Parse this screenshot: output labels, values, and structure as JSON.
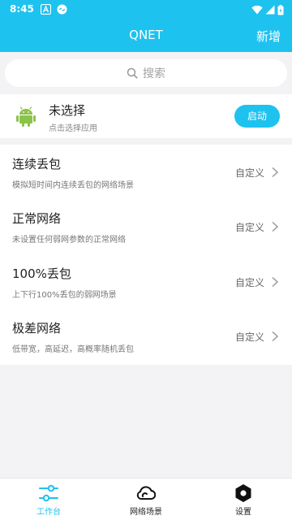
{
  "status_bar": {
    "time": "8:45"
  },
  "app_bar": {
    "title": "QNET",
    "add_label": "新增"
  },
  "search": {
    "placeholder": "搜索"
  },
  "app_selector": {
    "name": "未选择",
    "hint": "点击选择应用",
    "start_label": "启动"
  },
  "scenarios": [
    {
      "title": "连续丢包",
      "desc": "模拟短时间内连续丢包的网络场景",
      "label": "自定义"
    },
    {
      "title": "正常网络",
      "desc": "未设置任何弱网参数的正常网络",
      "label": "自定义"
    },
    {
      "title": "100%丢包",
      "desc": "上下行100%丢包的弱网场景",
      "label": "自定义"
    },
    {
      "title": "极差网络",
      "desc": "低带宽，高延迟，高概率随机丢包",
      "label": "自定义"
    }
  ],
  "bottom_nav": {
    "items": [
      {
        "label": "工作台",
        "icon": "sliders-icon",
        "active": true
      },
      {
        "label": "网络场景",
        "icon": "cloud-icon",
        "active": false
      },
      {
        "label": "设置",
        "icon": "hex-settings-icon",
        "active": false
      }
    ]
  },
  "colors": {
    "accent": "#1ec2ef",
    "background": "#f3f3f5"
  }
}
